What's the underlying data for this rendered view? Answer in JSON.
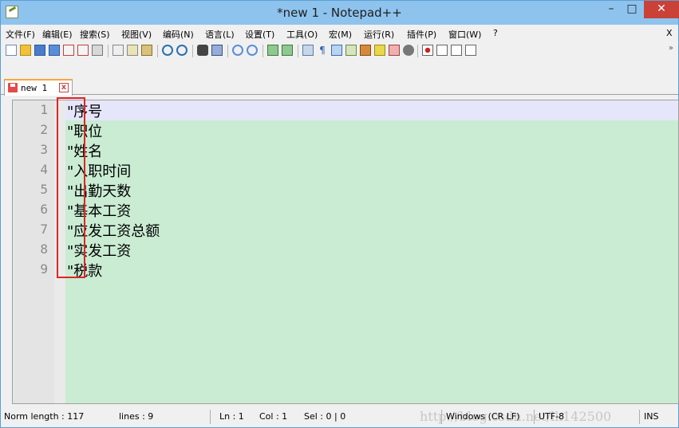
{
  "window": {
    "title": "*new 1 - Notepad++",
    "minimize": "–",
    "maximize": "□",
    "close": "✕"
  },
  "menu": [
    "文件(F)",
    "编辑(E)",
    "搜索(S)",
    "视图(V)",
    "编码(N)",
    "语言(L)",
    "设置(T)",
    "工具(O)",
    "宏(M)",
    "运行(R)",
    "插件(P)",
    "窗口(W)",
    "?",
    "X"
  ],
  "toolbar": {
    "more": "»"
  },
  "tab": {
    "label": "new 1",
    "close": "x"
  },
  "editor": {
    "lines": [
      {
        "num": "1",
        "text": "\"序号"
      },
      {
        "num": "2",
        "text": "\"职位"
      },
      {
        "num": "3",
        "text": "\"姓名"
      },
      {
        "num": "4",
        "text": "\"入职时间"
      },
      {
        "num": "5",
        "text": "\"出勤天数"
      },
      {
        "num": "6",
        "text": "\"基本工资"
      },
      {
        "num": "7",
        "text": "\"应发工资总额"
      },
      {
        "num": "8",
        "text": "\"实发工资"
      },
      {
        "num": "9",
        "text": "\"税款"
      }
    ]
  },
  "status": {
    "length": "Norm length : 117",
    "lines": "lines : 9",
    "ln": "Ln : 1",
    "col": "Col : 1",
    "sel": "Sel : 0 | 0",
    "eol": "Windows (CR LF)",
    "encoding": "UTF-8",
    "mode": "INS",
    "watermark": "http://blog.csdn.net/lk142500"
  }
}
